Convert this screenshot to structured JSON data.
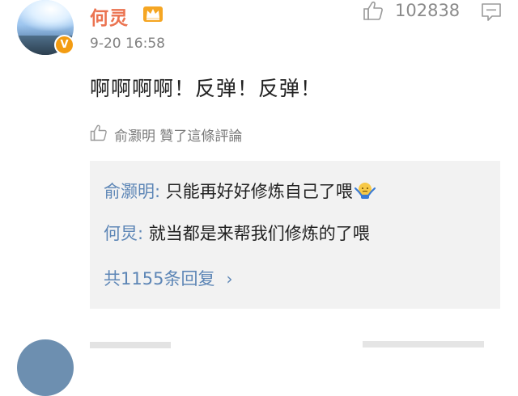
{
  "comment": {
    "author": "何灵",
    "verified_badge": "V",
    "crown_icon": "crown-icon",
    "timestamp": "9-20 16:58",
    "like_count": "102838",
    "text": "啊啊啊啊！反弹！反弹！",
    "liked_by": "俞灏明 贊了這條評論"
  },
  "replies": {
    "items": [
      {
        "author": "俞灏明",
        "separator": ": ",
        "text": "只能再好好修炼自己了喂",
        "emoji": "shrug-emoji"
      },
      {
        "author": "何炅",
        "separator": ": ",
        "text": "就当都是来帮我们修炼的了喂"
      }
    ],
    "more_label": "共1155条回复",
    "more_chevron": "›"
  },
  "colors": {
    "name": "#eb7350",
    "link": "#5d86b6",
    "reply_bg": "#f2f2f2",
    "muted": "#808080"
  }
}
